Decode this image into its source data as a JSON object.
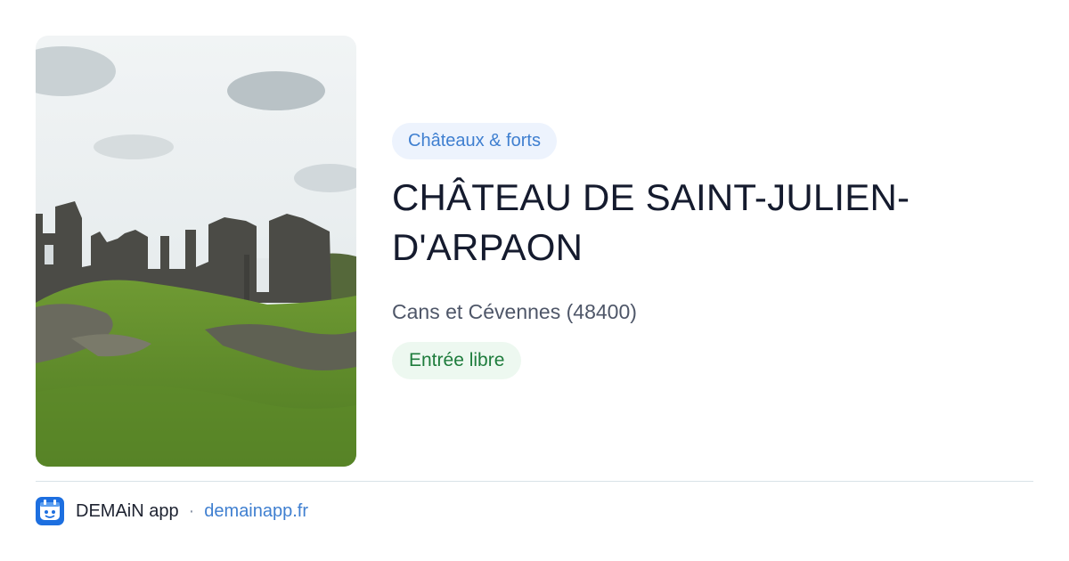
{
  "place": {
    "category": "Châteaux & forts",
    "title": "CHÂTEAU DE SAINT-JULIEN-D'ARPAON",
    "location": "Cans et Cévennes (48400)",
    "entry": "Entrée libre",
    "photo": "ruined-castle-photo"
  },
  "footer": {
    "app_name": "DEMAiN app",
    "separator": "·",
    "link": "demainapp.fr",
    "logo_icon": "demain-app-logo-icon"
  },
  "colors": {
    "category_chip_bg": "#edf3fd",
    "category_chip_text": "#3f7fd0",
    "title_text": "#151b2e",
    "location_text": "#4e5668",
    "entry_chip_bg": "#edf8f0",
    "entry_chip_text": "#1e7c3c",
    "link_text": "#3f7fd0",
    "logo_blue": "#1d6fe0"
  }
}
